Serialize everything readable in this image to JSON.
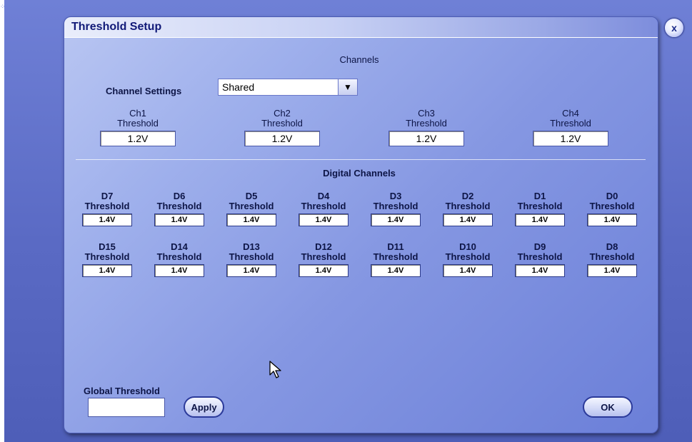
{
  "dialog": {
    "title": "Threshold Setup",
    "close_label": "x"
  },
  "channels": {
    "section_title": "Channels",
    "settings_label": "Channel Settings",
    "settings_value": "Shared",
    "items": [
      {
        "name": "Ch1",
        "sub": "Threshold",
        "value": "1.2V"
      },
      {
        "name": "Ch2",
        "sub": "Threshold",
        "value": "1.2V"
      },
      {
        "name": "Ch3",
        "sub": "Threshold",
        "value": "1.2V"
      },
      {
        "name": "Ch4",
        "sub": "Threshold",
        "value": "1.2V"
      }
    ]
  },
  "digital": {
    "section_title": "Digital Channels",
    "row1": [
      {
        "name": "D7",
        "sub": "Threshold",
        "value": "1.4V"
      },
      {
        "name": "D6",
        "sub": "Threshold",
        "value": "1.4V"
      },
      {
        "name": "D5",
        "sub": "Threshold",
        "value": "1.4V"
      },
      {
        "name": "D4",
        "sub": "Threshold",
        "value": "1.4V"
      },
      {
        "name": "D3",
        "sub": "Threshold",
        "value": "1.4V"
      },
      {
        "name": "D2",
        "sub": "Threshold",
        "value": "1.4V"
      },
      {
        "name": "D1",
        "sub": "Threshold",
        "value": "1.4V"
      },
      {
        "name": "D0",
        "sub": "Threshold",
        "value": "1.4V"
      }
    ],
    "row2": [
      {
        "name": "D15",
        "sub": "Threshold",
        "value": "1.4V"
      },
      {
        "name": "D14",
        "sub": "Threshold",
        "value": "1.4V"
      },
      {
        "name": "D13",
        "sub": "Threshold",
        "value": "1.4V"
      },
      {
        "name": "D12",
        "sub": "Threshold",
        "value": "1.4V"
      },
      {
        "name": "D11",
        "sub": "Threshold",
        "value": "1.4V"
      },
      {
        "name": "D10",
        "sub": "Threshold",
        "value": "1.4V"
      },
      {
        "name": "D9",
        "sub": "Threshold",
        "value": "1.4V"
      },
      {
        "name": "D8",
        "sub": "Threshold",
        "value": "1.4V"
      }
    ]
  },
  "global": {
    "label": "Global Threshold",
    "value": "",
    "apply_label": "Apply"
  },
  "footer": {
    "ok_label": "OK"
  }
}
